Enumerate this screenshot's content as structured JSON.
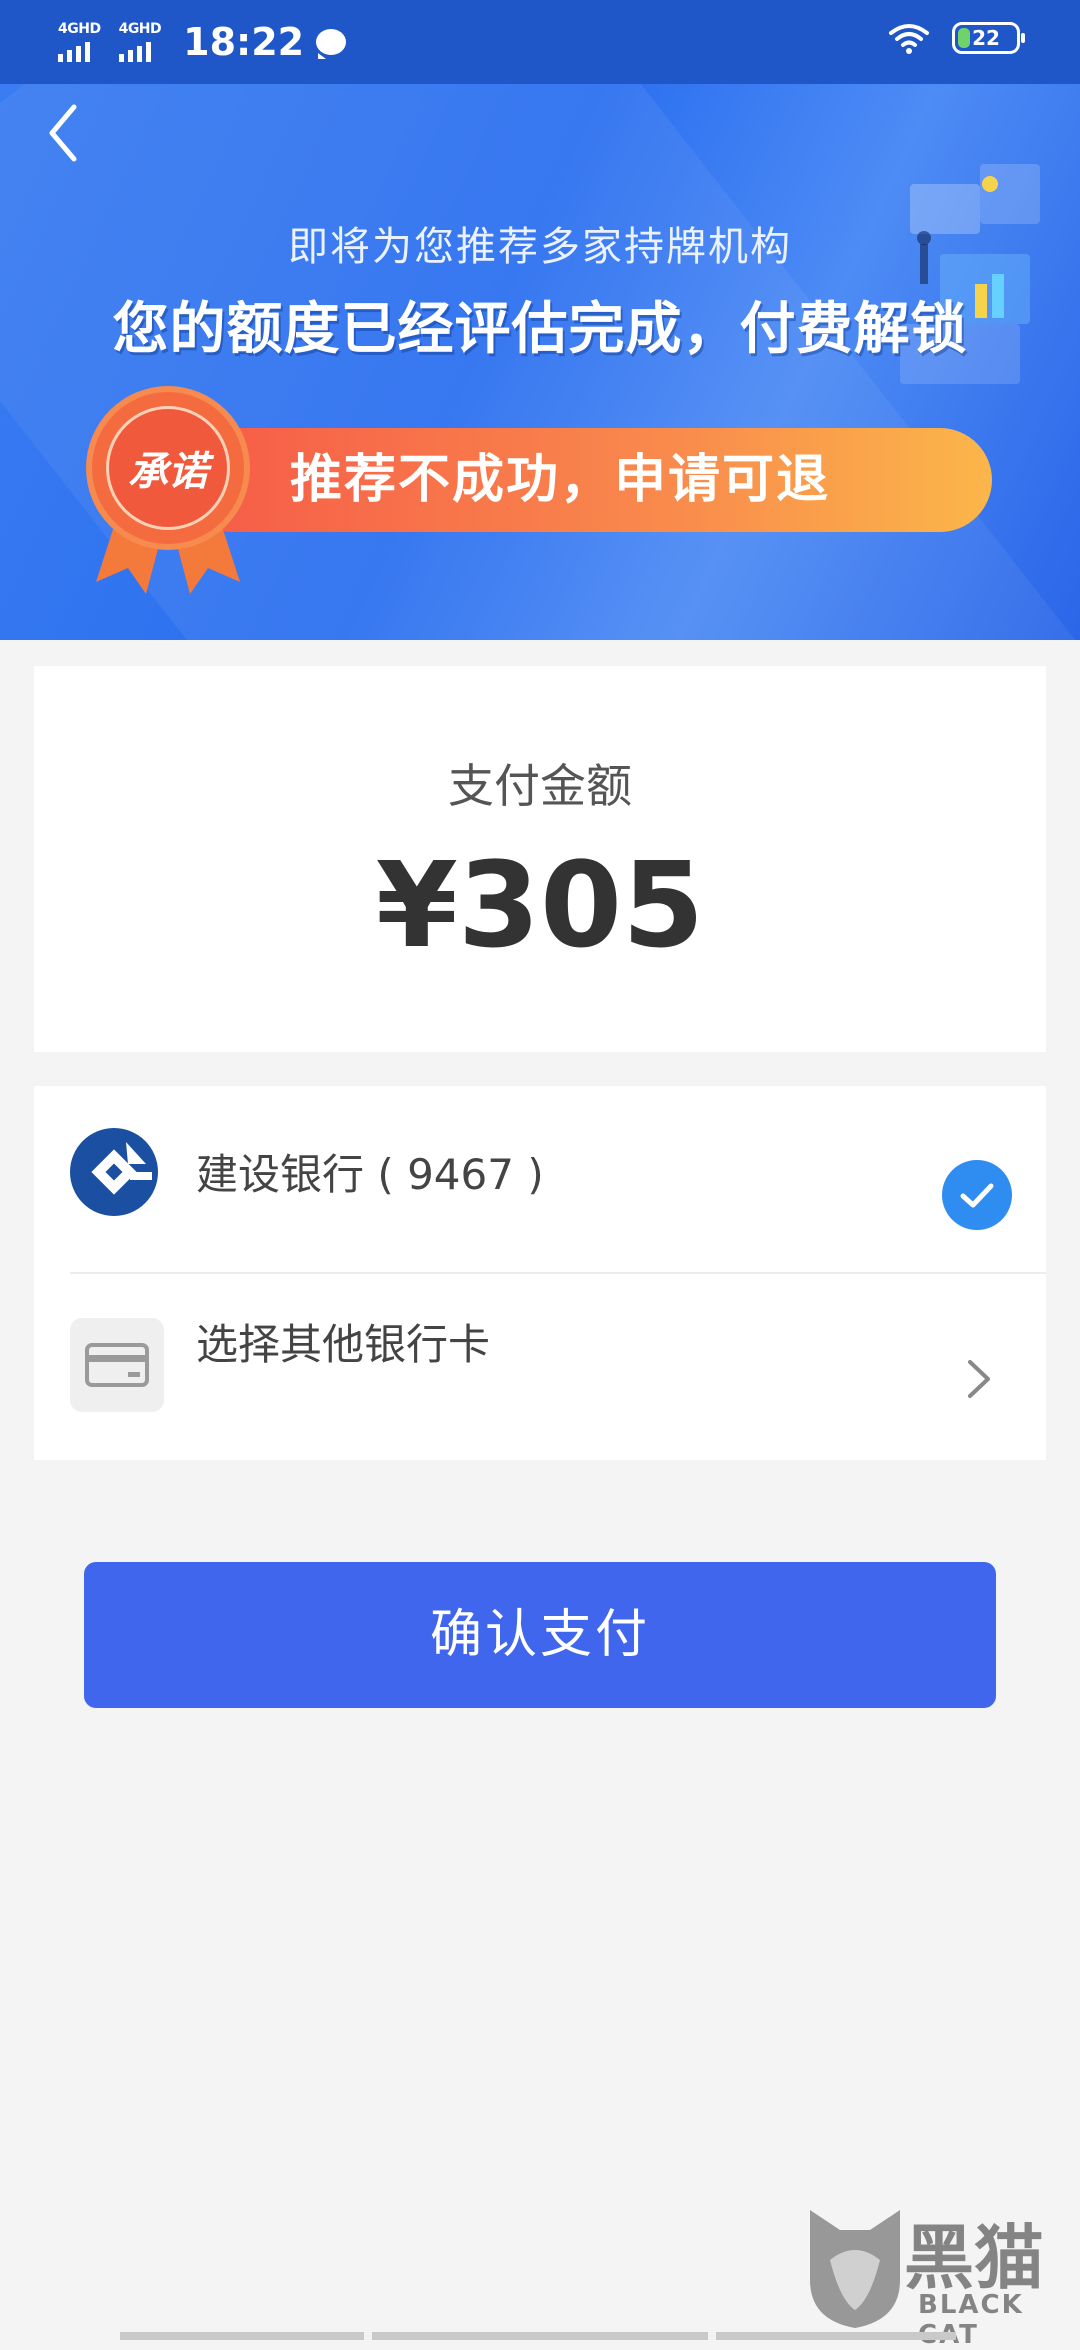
{
  "status_bar": {
    "signal_1": "4GHD",
    "signal_2": "4GHD",
    "time": "18:22",
    "battery_level": "22",
    "battery_fraction": 0.22
  },
  "banner": {
    "subtitle": "即将为您推荐多家持牌机构",
    "title": "您的额度已经评估完成，付费解锁",
    "badge_text": "承诺",
    "promise_text": "推荐不成功，申请可退"
  },
  "payment": {
    "amount_label": "支付金额",
    "amount_value": "¥305"
  },
  "methods": [
    {
      "label": "建设银行 ( 9467 )",
      "selected": true
    },
    {
      "label": "选择其他银行卡",
      "selected": false
    }
  ],
  "confirm_label": "确认支付",
  "watermark": {
    "text": "黑猫",
    "sub": "BLACK CAT"
  },
  "colors": {
    "status_bar": "#1f57c8",
    "banner": "#2b6ff0",
    "confirm_button": "#4066ee",
    "check": "#2f8cf0",
    "bank_logo": "#1a4fa1",
    "promise_pill_start": "#f65a48",
    "promise_pill_end": "#fbb64a"
  },
  "icons": [
    "back-arrow-icon",
    "chat-bubble-icon",
    "wifi-icon",
    "battery-icon",
    "ccb-bank-icon",
    "credit-card-icon",
    "checkmark-icon",
    "chevron-right-icon"
  ]
}
